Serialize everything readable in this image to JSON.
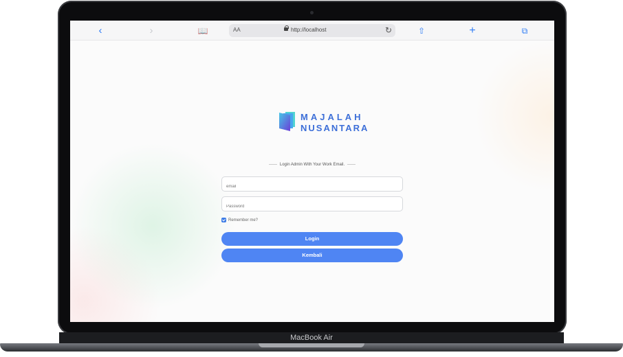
{
  "device": {
    "label": "MacBook Air"
  },
  "browser": {
    "text_size_label": "AA",
    "url": "http://localhost"
  },
  "brand": {
    "line1": "MAJALAH",
    "line2": "NUSANTARA"
  },
  "login": {
    "subtitle": "Login Admin With Your Work Email.",
    "email_placeholder": "email",
    "password_placeholder": "Password",
    "remember_label": "Remember me?",
    "login_button": "Login",
    "back_button": "Kembali"
  },
  "colors": {
    "primary": "#4f85f3",
    "brand_text": "#3d6fd8",
    "toolbar_icons": "#2f7df6"
  }
}
